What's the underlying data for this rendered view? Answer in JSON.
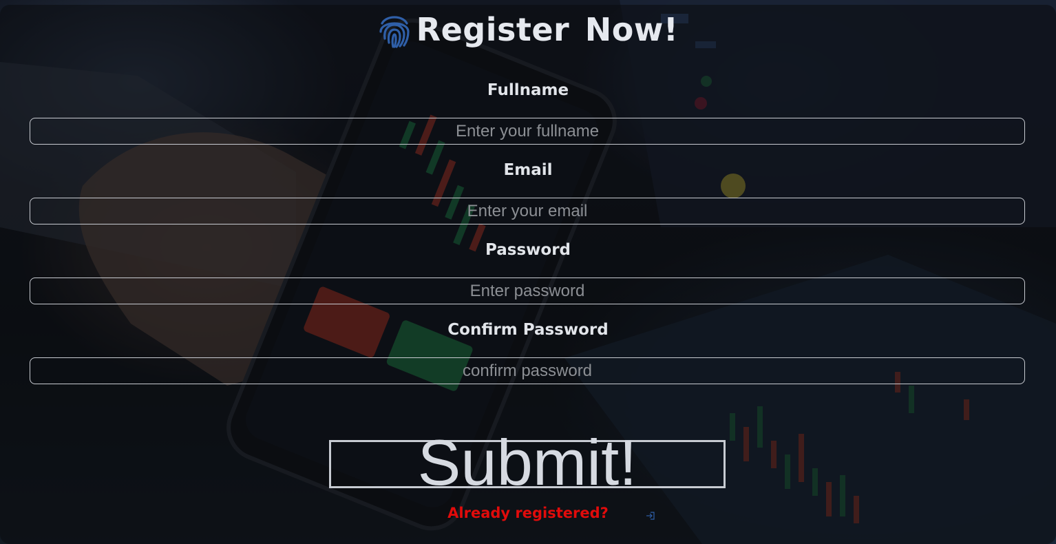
{
  "header": {
    "title": "Register Now!",
    "logo_icon": "fingerprint-icon",
    "logo_color": "#2f5fa8"
  },
  "form": {
    "fullname": {
      "label": "Fullname",
      "placeholder": "Enter your fullname",
      "value": ""
    },
    "email": {
      "label": "Email",
      "placeholder": "Enter your email",
      "value": ""
    },
    "password": {
      "label": "Password",
      "placeholder": "Enter password",
      "value": ""
    },
    "confirm_password": {
      "label": "Confirm Password",
      "placeholder": "confirm password",
      "value": ""
    },
    "submit_label": "Submit!"
  },
  "footer": {
    "login_link_label": "Already registered?",
    "login_link_color": "#e10b0b",
    "login_icon": "sign-in-icon"
  }
}
